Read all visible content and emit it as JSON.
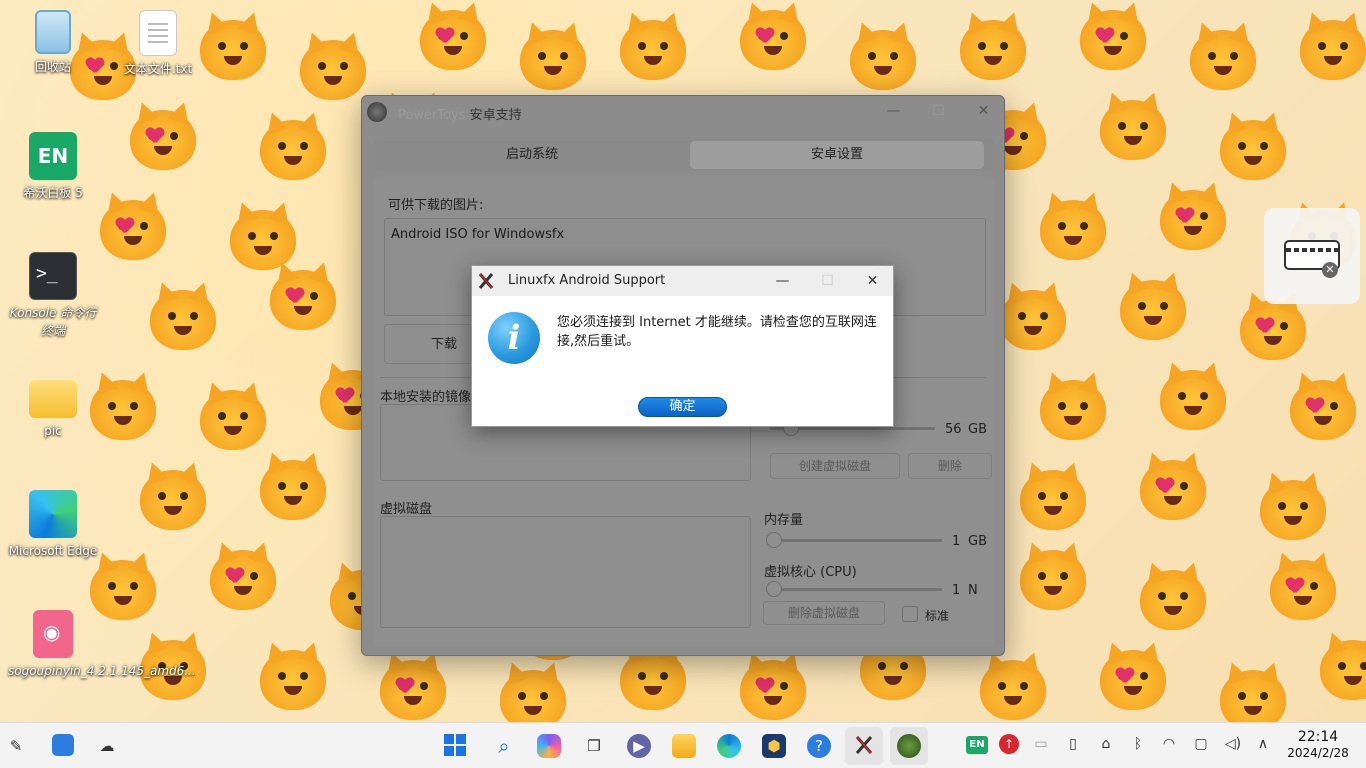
{
  "desktop": {
    "icons": [
      {
        "label": "回收站"
      },
      {
        "label": "文本文件.txt"
      },
      {
        "label": "希沃白板 5",
        "badge": "EN"
      },
      {
        "label": "Konsole 命令行终端"
      },
      {
        "label": "pic"
      },
      {
        "label": "Microsoft Edge"
      },
      {
        "label": "sogoupinyin_4.2.1.145_amd6..."
      }
    ]
  },
  "main_window": {
    "title": "PowerToys",
    "subtitle": "安卓支持",
    "tabs": [
      {
        "label": "启动系统"
      },
      {
        "label": "安卓设置"
      }
    ],
    "images_label": "可供下载的图片:",
    "images_list": [
      "Android ISO for Windowsfx"
    ],
    "download_label": "下载",
    "local_images_label": "本地安装的镜像",
    "disk_size_value": "56",
    "disk_size_unit": "GB",
    "create_disk_button": "创建虚拟磁盘",
    "delete_button": "删除",
    "virtual_disk_label": "虚拟磁盘",
    "memory_label": "内存量",
    "memory_value": "1",
    "memory_unit": "GB",
    "cpu_label": "虚拟核心 (CPU)",
    "cpu_value": "1",
    "cpu_unit": "N",
    "delete_disk_button": "删除虚拟磁盘",
    "standard_label": "标准"
  },
  "dialog": {
    "title": "Linuxfx Android Support",
    "message": "您必须连接到 Internet 才能继续。请检查您的互联网连接,然后重试。",
    "ok_button": "确定",
    "icon": "info-icon"
  },
  "taskbar": {
    "tray_ime": "EN",
    "time": "22:14",
    "date": "2024/2/28"
  }
}
